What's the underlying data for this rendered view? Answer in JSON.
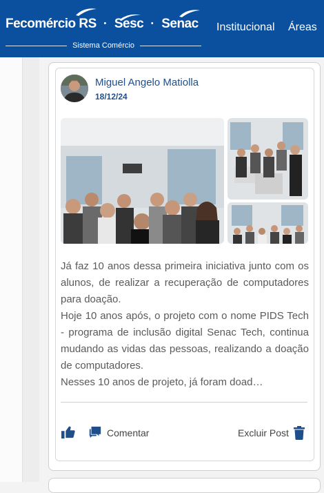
{
  "header": {
    "brand_fecomercio": "Fecomércio RS",
    "brand_sesc": "Sesc",
    "brand_senac": "Senac",
    "separator": "·",
    "tagline": "Sistema Comércio",
    "nav": [
      "Institucional",
      "Áreas"
    ],
    "bg_color": "#0b4f9f"
  },
  "post": {
    "author": "Miguel Angelo Matiolla",
    "date": "18/12/24",
    "paragraphs": [
      "Já faz 10 anos dessa primeira iniciativa junto com os alunos, de realizar a recuperação de computadores para doação.",
      "Hoje 10 anos após, o projeto com o nome PIDS Tech - programa de inclusão digital Senac Tech, continua mudando as vidas das pessoas, realizando a doação de computadores.",
      "Nesses 10 anos de projeto, já foram doad…"
    ],
    "actions": {
      "comment_label": "Comentar",
      "delete_label": "Excluir Post"
    },
    "icons": [
      "like-icon",
      "comment-icon",
      "trash-icon"
    ],
    "accent_color": "#1f4f8a"
  }
}
